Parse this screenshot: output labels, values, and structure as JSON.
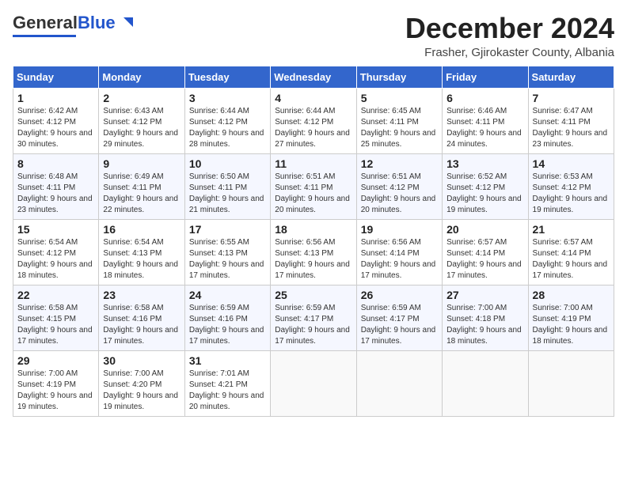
{
  "logo": {
    "general": "General",
    "blue": "Blue"
  },
  "title": "December 2024",
  "location": "Frasher, Gjirokaster County, Albania",
  "days_of_week": [
    "Sunday",
    "Monday",
    "Tuesday",
    "Wednesday",
    "Thursday",
    "Friday",
    "Saturday"
  ],
  "weeks": [
    [
      {
        "day": 1,
        "sunrise": "6:42 AM",
        "sunset": "4:12 PM",
        "daylight": "9 hours and 30 minutes."
      },
      {
        "day": 2,
        "sunrise": "6:43 AM",
        "sunset": "4:12 PM",
        "daylight": "9 hours and 29 minutes."
      },
      {
        "day": 3,
        "sunrise": "6:44 AM",
        "sunset": "4:12 PM",
        "daylight": "9 hours and 28 minutes."
      },
      {
        "day": 4,
        "sunrise": "6:44 AM",
        "sunset": "4:12 PM",
        "daylight": "9 hours and 27 minutes."
      },
      {
        "day": 5,
        "sunrise": "6:45 AM",
        "sunset": "4:11 PM",
        "daylight": "9 hours and 25 minutes."
      },
      {
        "day": 6,
        "sunrise": "6:46 AM",
        "sunset": "4:11 PM",
        "daylight": "9 hours and 24 minutes."
      },
      {
        "day": 7,
        "sunrise": "6:47 AM",
        "sunset": "4:11 PM",
        "daylight": "9 hours and 23 minutes."
      }
    ],
    [
      {
        "day": 8,
        "sunrise": "6:48 AM",
        "sunset": "4:11 PM",
        "daylight": "9 hours and 23 minutes."
      },
      {
        "day": 9,
        "sunrise": "6:49 AM",
        "sunset": "4:11 PM",
        "daylight": "9 hours and 22 minutes."
      },
      {
        "day": 10,
        "sunrise": "6:50 AM",
        "sunset": "4:11 PM",
        "daylight": "9 hours and 21 minutes."
      },
      {
        "day": 11,
        "sunrise": "6:51 AM",
        "sunset": "4:11 PM",
        "daylight": "9 hours and 20 minutes."
      },
      {
        "day": 12,
        "sunrise": "6:51 AM",
        "sunset": "4:12 PM",
        "daylight": "9 hours and 20 minutes."
      },
      {
        "day": 13,
        "sunrise": "6:52 AM",
        "sunset": "4:12 PM",
        "daylight": "9 hours and 19 minutes."
      },
      {
        "day": 14,
        "sunrise": "6:53 AM",
        "sunset": "4:12 PM",
        "daylight": "9 hours and 19 minutes."
      }
    ],
    [
      {
        "day": 15,
        "sunrise": "6:54 AM",
        "sunset": "4:12 PM",
        "daylight": "9 hours and 18 minutes."
      },
      {
        "day": 16,
        "sunrise": "6:54 AM",
        "sunset": "4:13 PM",
        "daylight": "9 hours and 18 minutes."
      },
      {
        "day": 17,
        "sunrise": "6:55 AM",
        "sunset": "4:13 PM",
        "daylight": "9 hours and 17 minutes."
      },
      {
        "day": 18,
        "sunrise": "6:56 AM",
        "sunset": "4:13 PM",
        "daylight": "9 hours and 17 minutes."
      },
      {
        "day": 19,
        "sunrise": "6:56 AM",
        "sunset": "4:14 PM",
        "daylight": "9 hours and 17 minutes."
      },
      {
        "day": 20,
        "sunrise": "6:57 AM",
        "sunset": "4:14 PM",
        "daylight": "9 hours and 17 minutes."
      },
      {
        "day": 21,
        "sunrise": "6:57 AM",
        "sunset": "4:14 PM",
        "daylight": "9 hours and 17 minutes."
      }
    ],
    [
      {
        "day": 22,
        "sunrise": "6:58 AM",
        "sunset": "4:15 PM",
        "daylight": "9 hours and 17 minutes."
      },
      {
        "day": 23,
        "sunrise": "6:58 AM",
        "sunset": "4:16 PM",
        "daylight": "9 hours and 17 minutes."
      },
      {
        "day": 24,
        "sunrise": "6:59 AM",
        "sunset": "4:16 PM",
        "daylight": "9 hours and 17 minutes."
      },
      {
        "day": 25,
        "sunrise": "6:59 AM",
        "sunset": "4:17 PM",
        "daylight": "9 hours and 17 minutes."
      },
      {
        "day": 26,
        "sunrise": "6:59 AM",
        "sunset": "4:17 PM",
        "daylight": "9 hours and 17 minutes."
      },
      {
        "day": 27,
        "sunrise": "7:00 AM",
        "sunset": "4:18 PM",
        "daylight": "9 hours and 18 minutes."
      },
      {
        "day": 28,
        "sunrise": "7:00 AM",
        "sunset": "4:19 PM",
        "daylight": "9 hours and 18 minutes."
      }
    ],
    [
      {
        "day": 29,
        "sunrise": "7:00 AM",
        "sunset": "4:19 PM",
        "daylight": "9 hours and 19 minutes."
      },
      {
        "day": 30,
        "sunrise": "7:00 AM",
        "sunset": "4:20 PM",
        "daylight": "9 hours and 19 minutes."
      },
      {
        "day": 31,
        "sunrise": "7:01 AM",
        "sunset": "4:21 PM",
        "daylight": "9 hours and 20 minutes."
      },
      null,
      null,
      null,
      null
    ]
  ]
}
